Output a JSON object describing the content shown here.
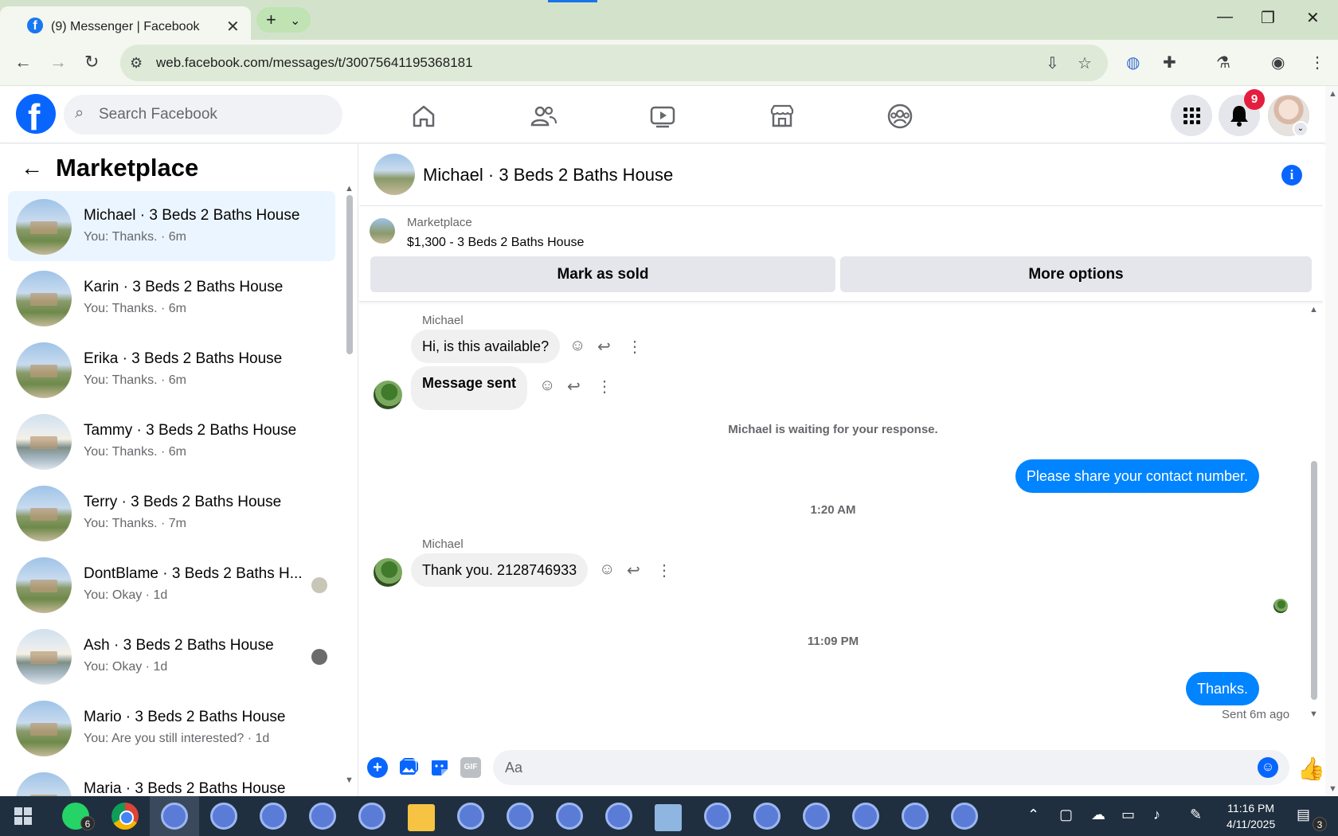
{
  "browser": {
    "tab_title": "(9) Messenger | Facebook",
    "url": "web.facebook.com/messages/t/30075641195368181"
  },
  "header": {
    "search_placeholder": "Search Facebook",
    "notification_count": "9"
  },
  "left": {
    "title": "Marketplace",
    "conversations": [
      {
        "name": "Michael · 3 Beds 2 Baths House",
        "preview": "You: Thanks. · 6m",
        "active": true
      },
      {
        "name": "Karin · 3 Beds 2 Baths House",
        "preview": "You: Thanks. · 6m"
      },
      {
        "name": "Erika · 3 Beds 2 Baths House",
        "preview": "You: Thanks. · 6m"
      },
      {
        "name": "Tammy · 3 Beds 2 Baths House",
        "preview": "You: Thanks. · 6m"
      },
      {
        "name": "Terry · 3 Beds 2 Baths House",
        "preview": "You: Thanks. · 7m"
      },
      {
        "name": "DontBlame · 3 Beds 2 Baths H...",
        "preview": "You: Okay · 1d"
      },
      {
        "name": "Ash · 3 Beds 2 Baths House",
        "preview": "You: Okay · 1d"
      },
      {
        "name": "Mario · 3 Beds 2 Baths House",
        "preview": "You: Are you still interested? · 1d"
      },
      {
        "name": "Maria · 3 Beds 2 Baths House",
        "preview": ""
      }
    ]
  },
  "chat": {
    "title": "Michael · 3 Beds 2 Baths House",
    "marketplace_label": "Marketplace",
    "listing": "$1,300 - 3 Beds 2 Baths House",
    "mark_sold": "Mark as sold",
    "more_options": "More options",
    "messages": {
      "sender1": "Michael",
      "msg1": "Hi, is this available?",
      "msg2": "Message sent",
      "waiting": "Michael is waiting for your response.",
      "out1": "Please share your contact number.",
      "time1": "1:20 AM",
      "sender2": "Michael",
      "msg3": "Thank you. 2128746933",
      "time2": "11:09 PM",
      "out2": "Thanks.",
      "sent_ago": "Sent 6m ago"
    },
    "composer_placeholder": "Aa",
    "gif_label": "GIF"
  },
  "taskbar": {
    "time": "11:16 PM",
    "date": "4/11/2025",
    "whatsapp_count": "6",
    "notif_count": "3"
  }
}
